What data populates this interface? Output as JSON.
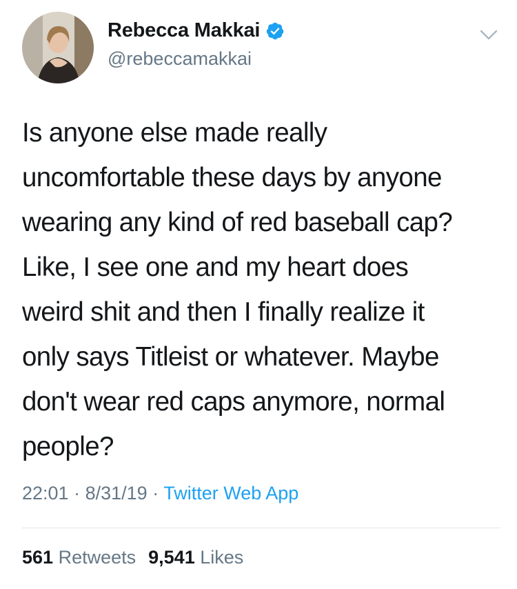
{
  "tweet": {
    "author": {
      "display_name": "Rebecca Makkai",
      "handle": "@rebeccamakkai",
      "verified": true
    },
    "text_lines": [
      "Is anyone else made really",
      "uncomfortable these days by anyone",
      "wearing any kind of red baseball cap?",
      "Like, I see one and my heart does",
      "weird shit and then I finally realize it",
      "only says Titleist or whatever. Maybe",
      "don't wear red caps anymore, normal",
      "people?"
    ],
    "time": "22:01",
    "date": "8/31/19",
    "separator": "·",
    "source": "Twitter Web App",
    "retweets_count": "561",
    "retweets_label": "Retweets",
    "likes_count": "9,541",
    "likes_label": "Likes"
  },
  "icons": {
    "verified": "verified-badge-icon",
    "menu": "chevron-down-icon"
  },
  "colors": {
    "text": "#14171a",
    "secondary": "#657786",
    "link": "#1da1f2",
    "divider": "#e1e8ed"
  }
}
